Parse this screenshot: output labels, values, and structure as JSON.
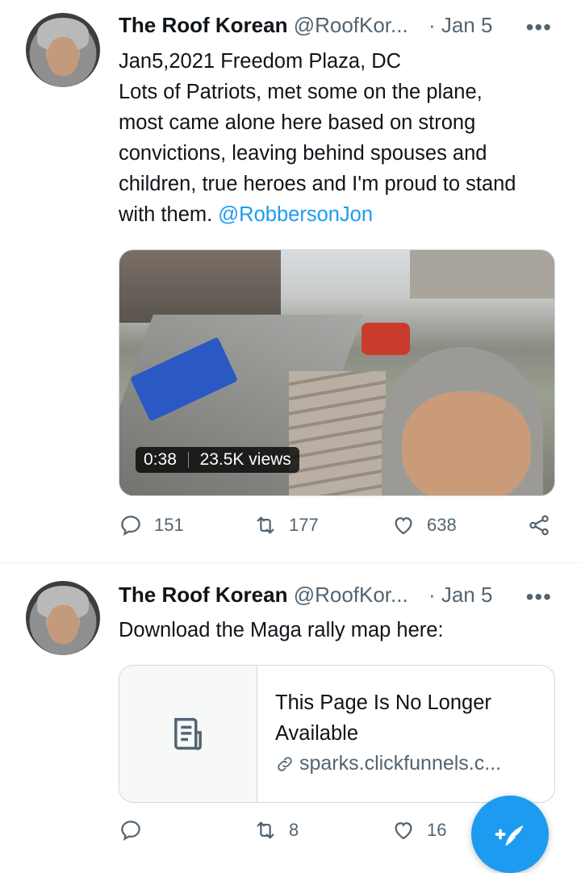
{
  "tweets": [
    {
      "author_name": "The Roof Korean",
      "handle": "@RoofKor...",
      "date": "· Jan 5",
      "more": "•••",
      "text_lines": [
        "Jan5,2021 Freedom Plaza, DC",
        "Lots of Patriots, met some on the plane,",
        "most came alone here based on strong",
        "convictions, leaving behind spouses and",
        "children, true heroes and I'm proud to stand"
      ],
      "last_line_prefix": "with them. ",
      "mention": "@RobbersonJon",
      "video": {
        "duration": "0:38",
        "views": "23.5K views"
      },
      "replies": "151",
      "retweets": "177",
      "likes": "638"
    },
    {
      "author_name": "The Roof Korean",
      "handle": "@RoofKor...",
      "date": "· Jan 5",
      "more": "•••",
      "text": "Download the Maga rally map here:",
      "card": {
        "title_line1": "This Page Is No Longer",
        "title_line2": "Available",
        "link": "sparks.clickfunnels.c..."
      },
      "replies": "",
      "retweets": "8",
      "likes": "16"
    }
  ],
  "icons": {
    "reply": "reply-icon",
    "retweet": "retweet-icon",
    "like": "heart-icon",
    "share": "share-icon",
    "compose": "compose-tweet-icon",
    "document": "document-icon",
    "link": "link-icon"
  },
  "colors": {
    "accent": "#1d9bf0",
    "secondary_text": "#536471",
    "text": "#0f1419"
  }
}
